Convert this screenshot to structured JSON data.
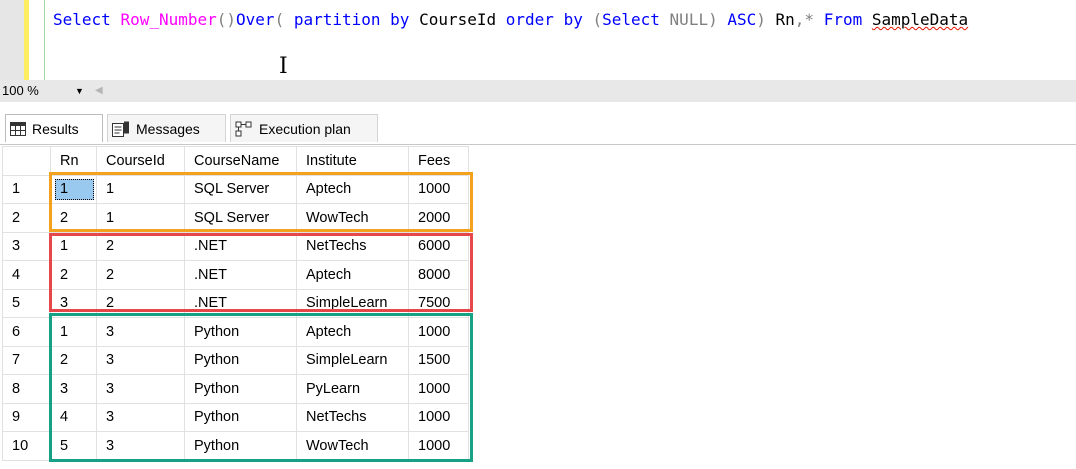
{
  "editor": {
    "query_tokens": [
      {
        "text": "Select ",
        "style": "kw"
      },
      {
        "text": "Row_Number",
        "style": "fn"
      },
      {
        "text": "()",
        "style": "gray"
      },
      {
        "text": "Over",
        "style": "kw"
      },
      {
        "text": "( ",
        "style": "gray"
      },
      {
        "text": "partition by ",
        "style": "kw"
      },
      {
        "text": "CourseId ",
        "style": ""
      },
      {
        "text": "order by ",
        "style": "kw"
      },
      {
        "text": "(",
        "style": "gray"
      },
      {
        "text": "Select ",
        "style": "kw"
      },
      {
        "text": "NULL",
        "style": "gray"
      },
      {
        "text": ") ",
        "style": "gray"
      },
      {
        "text": "ASC",
        "style": "kw"
      },
      {
        "text": ") ",
        "style": "gray"
      },
      {
        "text": "Rn",
        "style": ""
      },
      {
        "text": ",",
        "style": "gray"
      },
      {
        "text": "* ",
        "style": "gray"
      },
      {
        "text": "From ",
        "style": "kw"
      },
      {
        "text": "SampleData",
        "style": "squiggle"
      }
    ],
    "cursor_glyph": "I"
  },
  "zoom": {
    "value": "100 %",
    "arrow": "▼",
    "scroll_left": "◀"
  },
  "tabs": [
    {
      "label": "Results",
      "icon": "grid-icon",
      "active": true
    },
    {
      "label": "Messages",
      "icon": "messages-icon",
      "active": false
    },
    {
      "label": "Execution plan",
      "icon": "execution-plan-icon",
      "active": false
    }
  ],
  "grid": {
    "columns": [
      "Rn",
      "CourseId",
      "CourseName",
      "Institute",
      "Fees"
    ],
    "rows": [
      {
        "num": "1",
        "cells": [
          "1",
          "1",
          "SQL Server",
          "Aptech",
          "1000"
        ]
      },
      {
        "num": "2",
        "cells": [
          "2",
          "1",
          "SQL Server",
          "WowTech",
          "2000"
        ]
      },
      {
        "num": "3",
        "cells": [
          "1",
          "2",
          ".NET",
          "NetTechs",
          "6000"
        ]
      },
      {
        "num": "4",
        "cells": [
          "2",
          "2",
          ".NET",
          "Aptech",
          "8000"
        ]
      },
      {
        "num": "5",
        "cells": [
          "3",
          "2",
          ".NET",
          "SimpleLearn",
          "7500"
        ]
      },
      {
        "num": "6",
        "cells": [
          "1",
          "3",
          "Python",
          "Aptech",
          "1000"
        ]
      },
      {
        "num": "7",
        "cells": [
          "2",
          "3",
          "Python",
          "SimpleLearn",
          "1500"
        ]
      },
      {
        "num": "8",
        "cells": [
          "3",
          "3",
          "Python",
          "PyLearn",
          "1000"
        ]
      },
      {
        "num": "9",
        "cells": [
          "4",
          "3",
          "Python",
          "NetTechs",
          "1000"
        ]
      },
      {
        "num": "10",
        "cells": [
          "5",
          "3",
          "Python",
          "WowTech",
          "1000"
        ]
      }
    ],
    "selected_cell": {
      "row": 0,
      "col": 0
    },
    "highlight_colors": {
      "course_1": "#f4a21e",
      "course_2": "#e5474b",
      "course_3": "#16a085"
    }
  }
}
